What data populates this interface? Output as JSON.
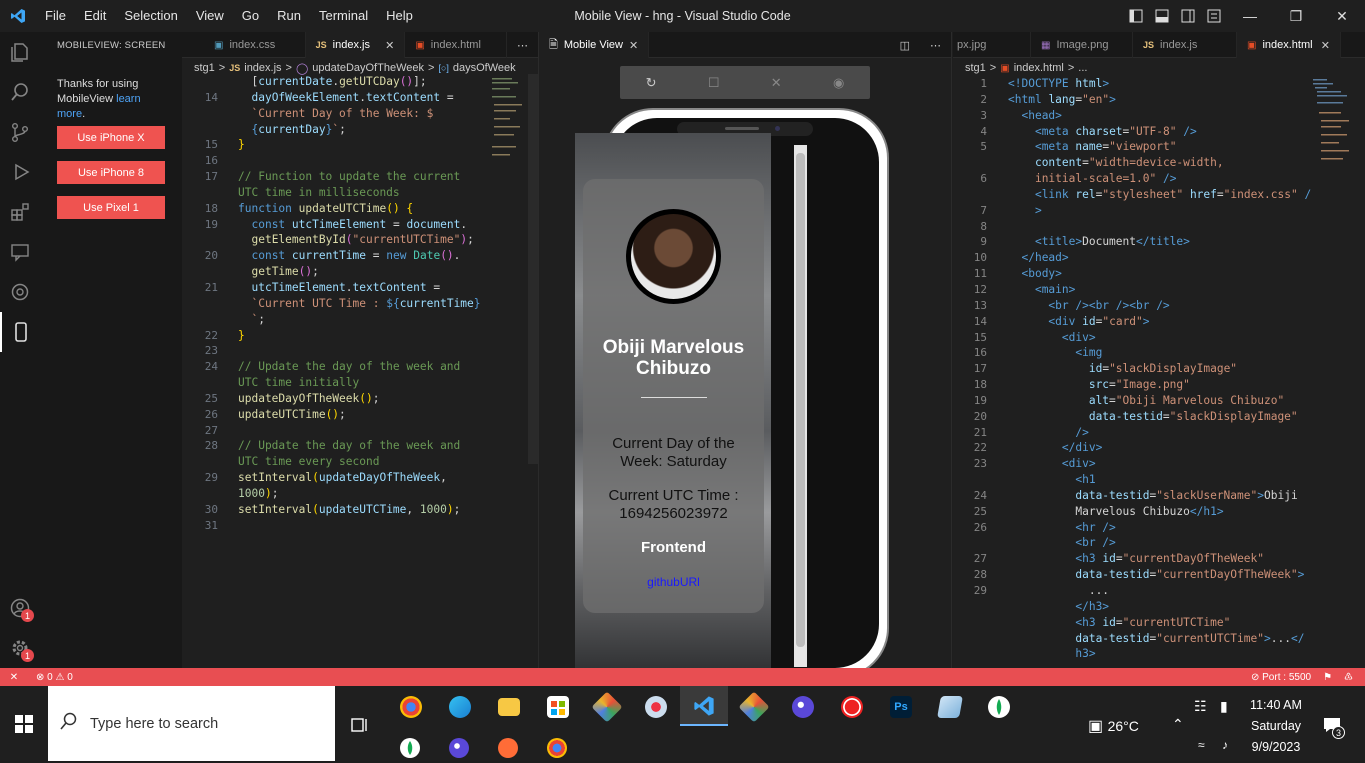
{
  "window": {
    "title": "Mobile View - hng - Visual Studio Code",
    "menu": [
      "File",
      "Edit",
      "Selection",
      "View",
      "Go",
      "Run",
      "Terminal",
      "Help"
    ]
  },
  "sidebar": {
    "header": "MOBILEVIEW: SCREEN",
    "message": "Thanks for using MobileView",
    "link": "learn more",
    "period": ".",
    "buttons": [
      "Use iPhone X",
      "Use iPhone 8",
      "Use Pixel 1"
    ]
  },
  "activity_badges": [
    "1",
    "1"
  ],
  "left_editor": {
    "tabs": [
      "index.css",
      "index.js",
      "index.html"
    ],
    "breadcrumb": [
      "stg1",
      ">",
      "index.js",
      ">",
      "updateDayOfTheWeek",
      ">",
      "daysOfWeek"
    ]
  },
  "mobile_view": {
    "tab": "Mobile View",
    "card": {
      "name": "Obiji Marvelous Chibuzo",
      "day": "Current Day of the Week: Saturday",
      "utc": "Current UTC Time : 1694256023972",
      "track": "Frontend",
      "link": "githubURl"
    }
  },
  "right_editor": {
    "tabs": [
      "px.jpg",
      "Image.png",
      "index.js",
      "index.html"
    ],
    "breadcrumb": [
      "stg1",
      ">",
      "index.html",
      ">",
      "..."
    ]
  },
  "statusbar": {
    "remote": "✕",
    "errors": "0",
    "warnings": "0",
    "port": "Port : 5500"
  },
  "taskbar": {
    "search_placeholder": "Type here to search",
    "weather": "26°C",
    "time": "11:40 AM",
    "day": "Saturday",
    "date": "9/9/2023",
    "notifications": "3"
  }
}
